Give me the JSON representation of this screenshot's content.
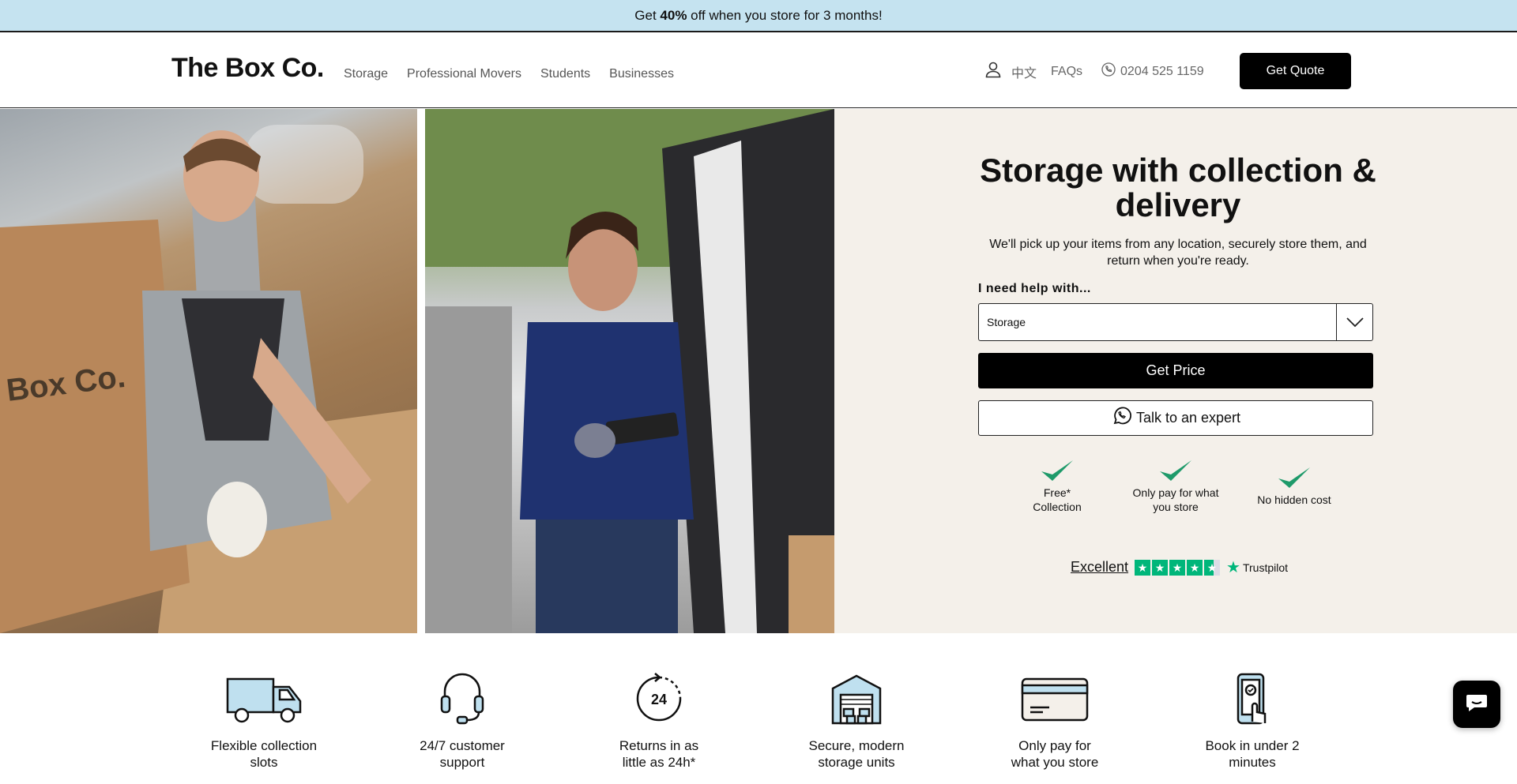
{
  "promo": {
    "prefix": "Get ",
    "highlight": "40%",
    "suffix": " off when you store for 3 months!"
  },
  "header": {
    "logo": "The Box Co.",
    "nav": [
      "Storage",
      "Professional Movers",
      "Students",
      "Businesses"
    ],
    "language": "中文",
    "faqs": "FAQs",
    "phone": "0204 525 1159",
    "quote_button": "Get Quote"
  },
  "hero": {
    "title": "Storage with collection & delivery",
    "subtitle": "We'll pick up your items from any location, securely store them, and return when you're ready.",
    "help_label": "I need help with...",
    "select_value": "Storage",
    "price_button": "Get Price",
    "expert_button": "Talk to an expert",
    "benefits": [
      "Free* Collection",
      "Only pay for what you store",
      "No hidden cost"
    ],
    "trust_label": "Excellent",
    "trustpilot": "Trustpilot",
    "image_text": "Box Co."
  },
  "features": [
    {
      "label": "Flexible collection slots",
      "icon": "van-icon"
    },
    {
      "label": "24/7 customer support",
      "icon": "headset-icon"
    },
    {
      "label": "Returns in as little as 24h*",
      "icon": "clock-24-icon"
    },
    {
      "label": "Secure, modern storage units",
      "icon": "warehouse-icon"
    },
    {
      "label": "Only pay for what you store",
      "icon": "card-icon"
    },
    {
      "label": "Book in under 2 minutes",
      "icon": "phone-booking-icon"
    }
  ],
  "colors": {
    "promo_bg": "#c5e3f0",
    "panel_bg": "#f4f0ea",
    "accent_green": "#1e9a6a",
    "trustpilot_green": "#00b67a"
  }
}
